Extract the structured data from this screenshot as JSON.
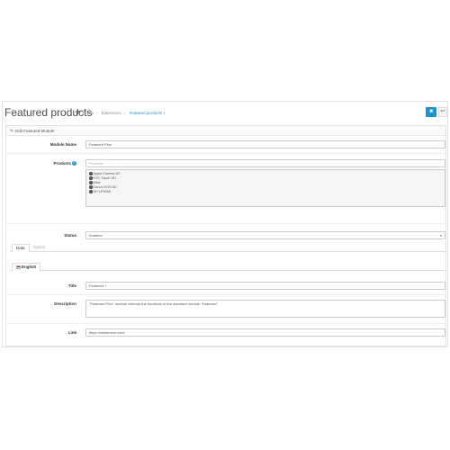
{
  "header": {
    "title": "Featured products",
    "title_suffix": "+",
    "breadcrumb": [
      "Home",
      "Extensions",
      "Featured products +"
    ],
    "save_icon": "save-icon",
    "back_icon": "reply-icon"
  },
  "panel": {
    "heading": "Edit Featured Module",
    "heading_icon": "pencil-icon"
  },
  "form": {
    "module_name": {
      "label": "Module Name",
      "value": "Featured Plus"
    },
    "products": {
      "label": "Products",
      "placeholder": "Products",
      "items": [
        "Apple Cinema 30\"",
        "HTC Touch HD",
        "iMac",
        "Canon EOS 5D",
        "HP LP3065"
      ]
    },
    "status": {
      "label": "Status",
      "value": "Enabled"
    },
    "tabs": [
      "Data",
      "Option"
    ],
    "language_tab": "English",
    "title": {
      "label": "Title",
      "value": "Featured +"
    },
    "description": {
      "label": "Description",
      "value": "\"Featured Plus\" module extends the functions of the standard module \"Featured\""
    },
    "link": {
      "label": "Link",
      "value": "https://webkrown.com/"
    }
  },
  "colors": {
    "accent": "#1e91cf"
  }
}
